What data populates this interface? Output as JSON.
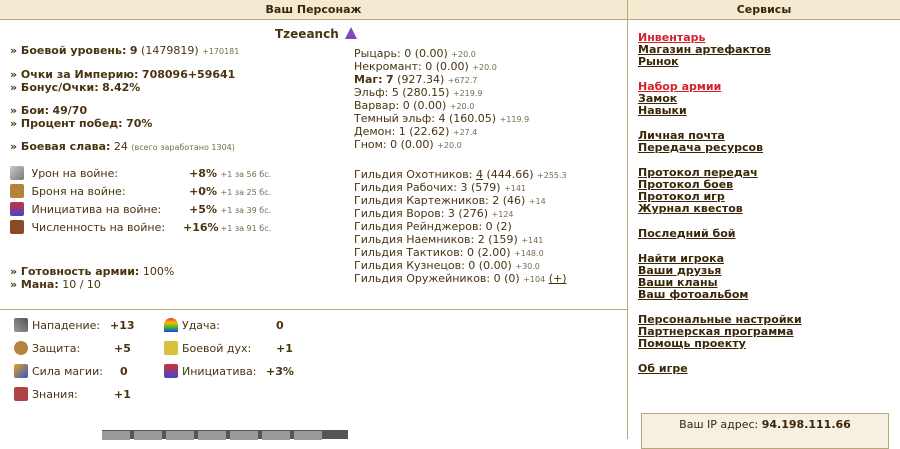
{
  "left_header": "Ваш Персонаж",
  "right_header": "Сервисы",
  "character_name": "Tzeeanch",
  "stats": {
    "combat_level_label": "» Боевой уровень:",
    "combat_level_value": "9",
    "combat_level_exp": "(1479819)",
    "combat_level_plus": "+170181",
    "empire_label": "» Очки за Империю:",
    "empire_value": "708096+59641",
    "bonus_label": "» Бонус/Очки:",
    "bonus_value": "8.42%",
    "battles_label": "» Бои:",
    "battles_value": "49/70",
    "winrate_label": "» Процент побед:",
    "winrate_value": "70%",
    "glory_label": "» Боевая слава:",
    "glory_value": "24",
    "glory_note": "(всего заработано 1304)"
  },
  "war_bonuses": [
    {
      "icon": "sword-icon",
      "label": "Урон на войне:",
      "value": "+8%",
      "note": "+1 за 56 бс."
    },
    {
      "icon": "armor-icon",
      "label": "Броня на войне:",
      "value": "+0%",
      "note": "+1 за 25 бс."
    },
    {
      "icon": "scroll-icon",
      "label": "Инициатива на войне:",
      "value": "+5%",
      "note": "+1 за 39 бс."
    },
    {
      "icon": "army-icon",
      "label": "Численность на войне:",
      "value": "+16%",
      "note": "+1 за 91 бс."
    }
  ],
  "readiness_label": "» Готовность армии:",
  "readiness_value": "100%",
  "mana_label": "» Мана:",
  "mana_value": "10 / 10",
  "factions": [
    {
      "label": "Рыцарь:",
      "value": "0 (0.00)",
      "plus": "+20.0",
      "bold": false
    },
    {
      "label": "Некромант:",
      "value": "0 (0.00)",
      "plus": "+20.0",
      "bold": false
    },
    {
      "label": "Маг:",
      "value": "7",
      "rest": "(927.34)",
      "plus": "+672.7",
      "bold": true
    },
    {
      "label": "Эльф:",
      "value": "5 (280.15)",
      "plus": "+219.9",
      "bold": false
    },
    {
      "label": "Варвар:",
      "value": "0 (0.00)",
      "plus": "+20.0",
      "bold": false
    },
    {
      "label": "Темный эльф:",
      "value": "4 (160.05)",
      "plus": "+119.9",
      "bold": false
    },
    {
      "label": "Демон:",
      "value": "1 (22.62)",
      "plus": "+27.4",
      "bold": false
    },
    {
      "label": "Гном:",
      "value": "0 (0.00)",
      "plus": "+20.0",
      "bold": false
    }
  ],
  "guilds": [
    {
      "label": "Гильдия Охотников:",
      "value": "4",
      "rest": "(444.66)",
      "plus": "+255.3"
    },
    {
      "label": "Гильдия Рабочих:",
      "value": "3 (579)",
      "rest": "",
      "plus": "+141"
    },
    {
      "label": "Гильдия Картежников:",
      "value": "2 (46)",
      "rest": "",
      "plus": "+14"
    },
    {
      "label": "Гильдия Воров:",
      "value": "3 (276)",
      "rest": "",
      "plus": "+124"
    },
    {
      "label": "Гильдия Рейнджеров:",
      "value": "0 (2)",
      "rest": "",
      "plus": ""
    },
    {
      "label": "Гильдия Наемников:",
      "value": "2 (159)",
      "rest": "",
      "plus": "+141"
    },
    {
      "label": "Гильдия Тактиков:",
      "value": "0 (2.00)",
      "rest": "",
      "plus": "+148.0"
    },
    {
      "label": "Гильдия Кузнецов:",
      "value": "0 (0.00)",
      "rest": "",
      "plus": "+30.0"
    },
    {
      "label": "Гильдия Оружейников:",
      "value": "0 (0)",
      "rest": "",
      "plus": "+104",
      "extra": "(+)"
    }
  ],
  "attributes": [
    {
      "icon": "attack-icon",
      "label": "Нападение:",
      "value": "+13"
    },
    {
      "icon": "luck-icon",
      "label": "Удача:",
      "value": "0"
    },
    {
      "icon": "shield-icon",
      "label": "Защита:",
      "value": "+5"
    },
    {
      "icon": "morale-icon",
      "label": "Боевой дух:",
      "value": "+1"
    },
    {
      "icon": "magic-wand-icon",
      "label": "Сила магии:",
      "value": "0"
    },
    {
      "icon": "initiative-icon",
      "label": "Инициатива:",
      "value": "+3%"
    },
    {
      "icon": "knowledge-book-icon",
      "label": "Знания:",
      "value": "+1"
    }
  ],
  "menu": [
    {
      "label": "Инвентарь",
      "red": true,
      "gap": false
    },
    {
      "label": "Магазин артефактов",
      "red": false,
      "gap": false
    },
    {
      "label": "Рынок",
      "red": false,
      "gap": false
    },
    {
      "label": "Набор армии",
      "red": true,
      "gap": true
    },
    {
      "label": "Замок",
      "red": false,
      "gap": false
    },
    {
      "label": "Навыки",
      "red": false,
      "gap": false
    },
    {
      "label": "Личная почта",
      "red": false,
      "gap": true
    },
    {
      "label": "Передача ресурсов",
      "red": false,
      "gap": false
    },
    {
      "label": "Протокол передач",
      "red": false,
      "gap": true
    },
    {
      "label": "Протокол боев",
      "red": false,
      "gap": false
    },
    {
      "label": "Протокол игр",
      "red": false,
      "gap": false
    },
    {
      "label": "Журнал квестов",
      "red": false,
      "gap": false
    },
    {
      "label": "Последний бой",
      "red": false,
      "gap": true
    },
    {
      "label": "Найти игрока",
      "red": false,
      "gap": true
    },
    {
      "label": "Ваши друзья",
      "red": false,
      "gap": false
    },
    {
      "label": "Ваши кланы",
      "red": false,
      "gap": false
    },
    {
      "label": "Ваш фотоальбом",
      "red": false,
      "gap": false
    },
    {
      "label": "Персональные настройки",
      "red": false,
      "gap": true
    },
    {
      "label": "Партнерская программа",
      "red": false,
      "gap": false
    },
    {
      "label": "Помощь проекту",
      "red": false,
      "gap": false
    },
    {
      "label": "Об игре",
      "red": false,
      "gap": true
    }
  ],
  "ip_label": "Ваш IP адрес:",
  "ip_value": "94.198.111.66",
  "colors": {
    "link_red": "#d2222a",
    "header_bg": "#f4ead2",
    "border": "#b9a57a"
  }
}
